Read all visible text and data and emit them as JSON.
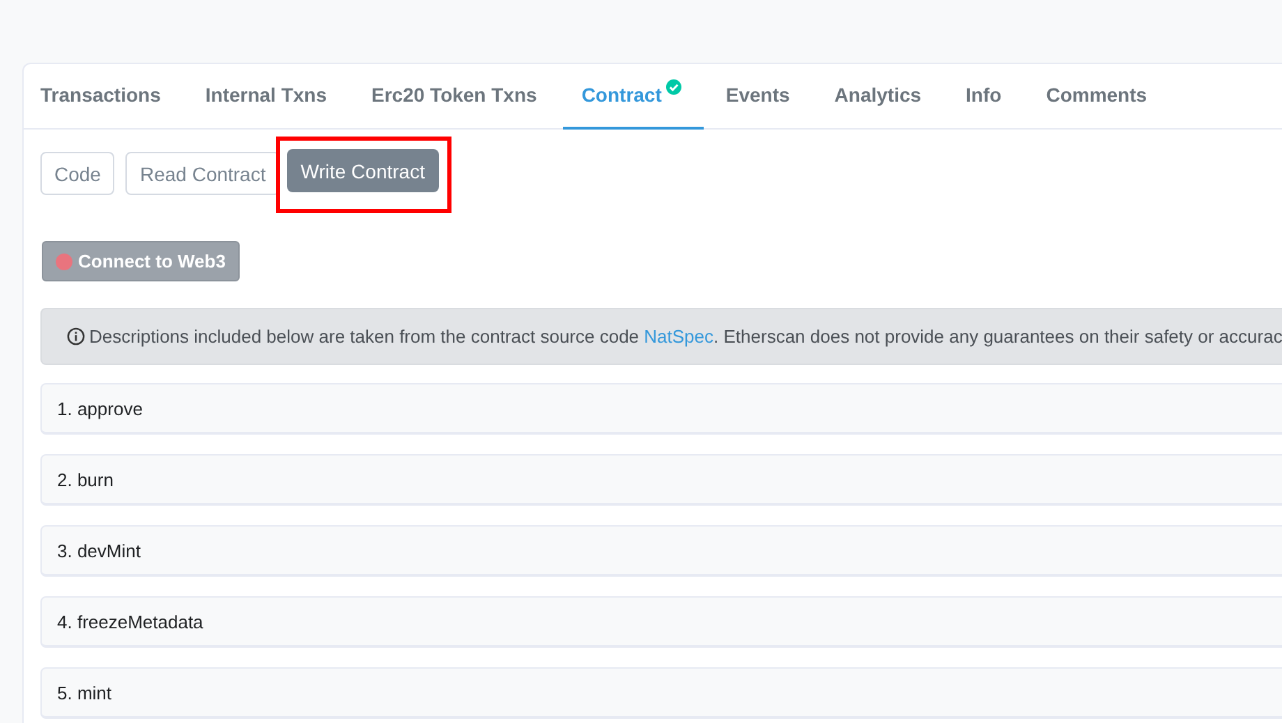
{
  "tabs": [
    {
      "label": "Transactions",
      "selected": false,
      "verified": false
    },
    {
      "label": "Internal Txns",
      "selected": false,
      "verified": false
    },
    {
      "label": "Erc20 Token Txns",
      "selected": false,
      "verified": false
    },
    {
      "label": "Contract",
      "selected": true,
      "verified": true
    },
    {
      "label": "Events",
      "selected": false,
      "verified": false
    },
    {
      "label": "Analytics",
      "selected": false,
      "verified": false
    },
    {
      "label": "Info",
      "selected": false,
      "verified": false
    },
    {
      "label": "Comments",
      "selected": false,
      "verified": false
    }
  ],
  "subtabs": [
    {
      "label": "Code",
      "selected": false,
      "highlighted": false
    },
    {
      "label": "Read Contract",
      "selected": false,
      "highlighted": false
    },
    {
      "label": "Write Contract",
      "selected": true,
      "highlighted": true
    }
  ],
  "connect_button": {
    "label": "Connect to Web3",
    "connected": false
  },
  "notice": {
    "text_before": "Descriptions included below are taken from the contract source code ",
    "link": "NatSpec",
    "text_after": ". Etherscan does not provide any guarantees on their safety or accurac"
  },
  "functions": [
    "1. approve",
    "2. burn",
    "3. devMint",
    "4. freezeMetadata",
    "5. mint"
  ]
}
